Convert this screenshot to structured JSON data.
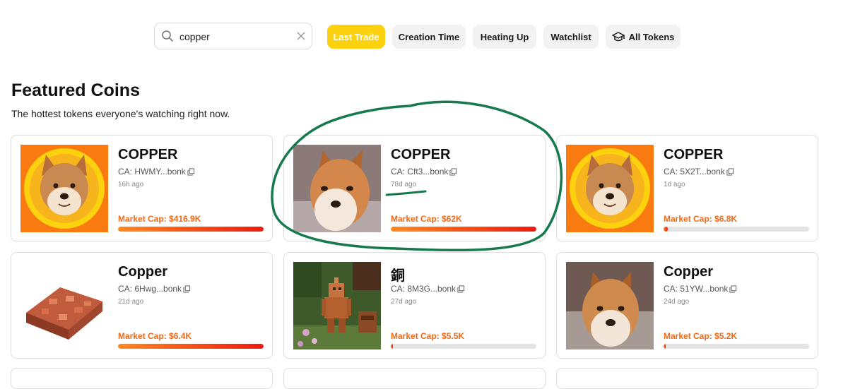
{
  "search": {
    "value": "copper"
  },
  "filters": [
    {
      "label": "Last Trade",
      "active": true
    },
    {
      "label": "Creation Time",
      "active": false
    },
    {
      "label": "Heating Up",
      "active": false
    },
    {
      "label": "Watchlist",
      "active": false
    },
    {
      "label": "All Tokens",
      "active": false,
      "icon": "graduation-cap-icon"
    }
  ],
  "featured": {
    "title": "Featured Coins",
    "subtitle": "The hottest tokens everyone's watching right now."
  },
  "cards": [
    {
      "name": "COPPER",
      "ca": "CA: HWMY...bonk",
      "age": "16h ago",
      "market_cap": "Market Cap: $416.9K",
      "progress": 1.0,
      "image": "shiba-coin-logo"
    },
    {
      "name": "COPPER",
      "ca": "CA: Cft3...bonk",
      "age": "78d ago",
      "market_cap": "Market Cap: $62K",
      "progress": 1.0,
      "image": "shiba-photo",
      "circled": true
    },
    {
      "name": "COPPER",
      "ca": "CA: 5X2T...bonk",
      "age": "1d ago",
      "market_cap": "Market Cap: $6.8K",
      "progress": 0.03,
      "image": "shiba-coin-logo"
    },
    {
      "name": "Copper",
      "ca": "CA: 6Hwg...bonk",
      "age": "21d ago",
      "market_cap": "Market Cap: $6.4K",
      "progress": 1.0,
      "image": "copper-ingot-pixel"
    },
    {
      "name": "銅",
      "ca": "CA: 8M3G...bonk",
      "age": "27d ago",
      "market_cap": "Market Cap: $5.5K",
      "progress": 0.01,
      "image": "copper-golem-scene"
    },
    {
      "name": "Copper",
      "ca": "CA: 51YW...bonk",
      "age": "24d ago",
      "market_cap": "Market Cap: $5.2K",
      "progress": 0.005,
      "image": "shiba-photo-close"
    }
  ],
  "colors": {
    "accent": "#fcd20f",
    "market_cap_text": "#f06a1a",
    "bar_start": "#ff8a1c",
    "bar_end": "#f01a0f",
    "annotation": "#177a4d"
  }
}
